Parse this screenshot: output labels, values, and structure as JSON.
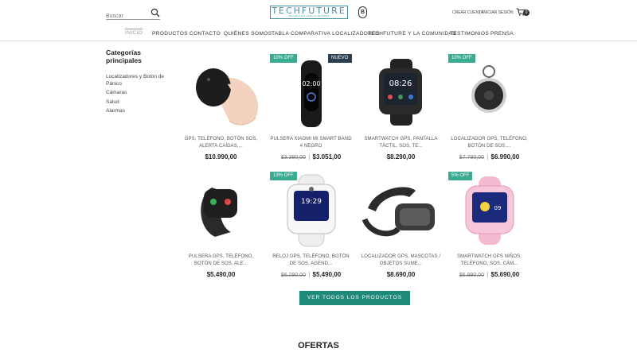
{
  "header": {
    "search_placeholder": "Buscar",
    "logo_name": "TECHFUTURE",
    "logo_tagline": "TECNOLOGÍA PARA CUIDARNOS",
    "bcorp_letter": "B",
    "create_account": "CREAR CUENTA",
    "separator": "|",
    "login": "INICIAR SESIÓN",
    "cart_count": "0"
  },
  "nav": [
    "INICIO",
    "PRODUCTOS",
    "CONTACTO",
    "QUIÉNES SOMOS",
    "TABLA COMPARATIVA LOCALIZADORES",
    "TECHFUTURE Y LA COMUNIDAD",
    "TESTIMONIOS",
    "PRENSA"
  ],
  "sidebar": {
    "title": "Categorías principales",
    "items": [
      "Localizadores y Botón de Pánico",
      "Cámaras",
      "Salud",
      "Alarmas"
    ]
  },
  "products": [
    {
      "name": "GPS, TELÉFONO, BOTÓN SOS, ALERTA CAÍDAS,...",
      "old_price": "",
      "price": "$10.990,00",
      "badge": "",
      "badge_new": ""
    },
    {
      "name": "PULSERA XIAOMI MI SMART BAND 4 NEGRO",
      "old_price": "$3.390,00",
      "price": "$3.051,00",
      "badge": "10% OFF",
      "badge_new": "NUEVO"
    },
    {
      "name": "SMARTWATCH GPS, PANTALLA TÁCTIL, SOS, TE...",
      "old_price": "",
      "price": "$8.290,00",
      "badge": "",
      "badge_new": ""
    },
    {
      "name": "LOCALIZADOR GPS, TELÉFONO, BOTÓN DE SOS,...",
      "old_price": "$7.790,00",
      "price": "$6.990,00",
      "badge": "10% OFF",
      "badge_new": ""
    },
    {
      "name": "PULSERA GPS, TELÉFONO, BOTÓN DE SOS, ALE...",
      "old_price": "",
      "price": "$5.490,00",
      "badge": "",
      "badge_new": ""
    },
    {
      "name": "RELOJ GPS, TELÉFONO, BOTÓN DE SOS, AGEND...",
      "old_price": "$6.290,00",
      "price": "$5.490,00",
      "badge": "13% OFF",
      "badge_new": ""
    },
    {
      "name": "LOCALIZADOR GPS, MASCOTAS / OBJETOS SUME...",
      "old_price": "",
      "price": "$8.690,00",
      "badge": "",
      "badge_new": ""
    },
    {
      "name": "SMARTWATCH GPS NIÑOS, TELÉFONO, SOS, CÁM...",
      "old_price": "$5.990,00",
      "price": "$5.690,00",
      "badge": "5% OFF",
      "badge_new": ""
    }
  ],
  "cta_label": "VER TODOS LOS PRODUCTOS",
  "section_title": "OFERTAS",
  "product_images": [
    "black-pebble-tracker-in-hand",
    "black-fitness-band",
    "black-square-smartwatch",
    "round-key-tracker",
    "black-sos-wristband",
    "white-kids-smartwatch",
    "dark-pet-tracker",
    "pink-kids-smartwatch"
  ],
  "colors": {
    "accent": "#1f8a7a",
    "badge_off": "#3aaa90",
    "badge_new": "#2c3f4e",
    "logo": "#4a8ea3"
  }
}
